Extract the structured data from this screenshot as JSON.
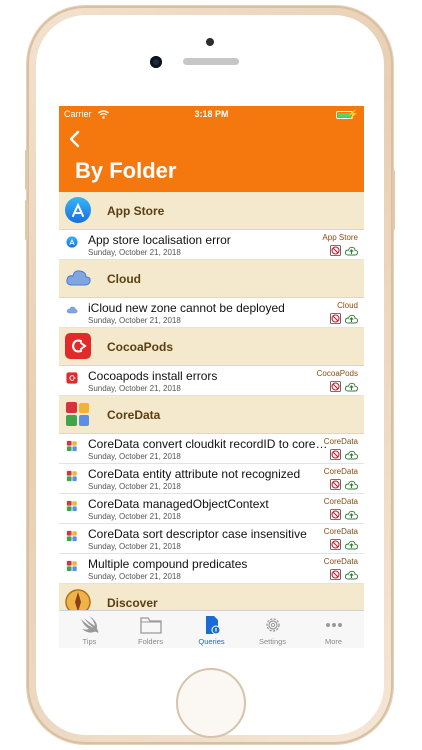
{
  "status_bar": {
    "carrier": "Carrier",
    "time": "3:18 PM"
  },
  "nav": {
    "back_icon": "chevron-left-icon",
    "title": "By Folder"
  },
  "colors": {
    "accent": "#f5780f",
    "section_bg": "#f4e8cd",
    "tab_active": "#1a6bd6"
  },
  "sections": [
    {
      "label": "App Store",
      "icon": "app-store-icon",
      "rows": [
        {
          "title": "App store localisation error",
          "date": "Sunday, October 21, 2018",
          "tag": "App Store"
        }
      ]
    },
    {
      "label": "Cloud",
      "icon": "cloud-icon",
      "rows": [
        {
          "title": "iCloud new zone cannot be deployed",
          "date": "Sunday, October 21, 2018",
          "tag": "Cloud"
        }
      ]
    },
    {
      "label": "CocoaPods",
      "icon": "cocoapods-icon",
      "rows": [
        {
          "title": "Cocoapods install errors",
          "date": "Sunday, October 21, 2018",
          "tag": "CocoaPods"
        }
      ]
    },
    {
      "label": "CoreData",
      "icon": "coredata-icon",
      "rows": [
        {
          "title": "CoreData convert cloudkit recordID to coreda...",
          "date": "Sunday, October 21, 2018",
          "tag": "CoreData"
        },
        {
          "title": "CoreData entity attribute not recognized",
          "date": "Sunday, October 21, 2018",
          "tag": "CoreData"
        },
        {
          "title": "CoreData managedObjectContext",
          "date": "Sunday, October 21, 2018",
          "tag": "CoreData"
        },
        {
          "title": "CoreData sort descriptor case insensitive",
          "date": "Sunday, October 21, 2018",
          "tag": "CoreData"
        },
        {
          "title": "Multiple compound predicates",
          "date": "Sunday, October 21, 2018",
          "tag": "CoreData"
        }
      ]
    },
    {
      "label": "Discover",
      "icon": "discover-icon",
      "rows": []
    }
  ],
  "tabs": [
    {
      "label": "Tips",
      "icon": "swift-icon"
    },
    {
      "label": "Folders",
      "icon": "folder-icon"
    },
    {
      "label": "Queries",
      "icon": "document-icon",
      "active": true
    },
    {
      "label": "Settings",
      "icon": "gear-icon"
    },
    {
      "label": "More",
      "icon": "more-icon"
    }
  ]
}
